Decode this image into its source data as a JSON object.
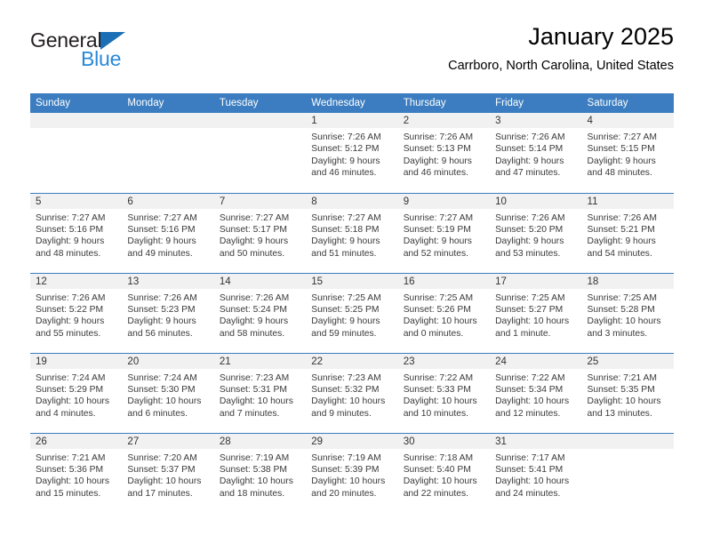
{
  "brand": {
    "name_top": "General",
    "name_bottom": "Blue",
    "triangle_icon": "triangle-icon",
    "accent_dark": "#1b6fb5",
    "accent_light": "#2789d8"
  },
  "header": {
    "title": "January 2025",
    "location": "Carrboro, North Carolina, United States"
  },
  "theme": {
    "header_bar": "#3b7dc0",
    "daynum_band": "#f1f1f1",
    "text": "#3a3a3a"
  },
  "calendar": {
    "weekday_headers": [
      "Sunday",
      "Monday",
      "Tuesday",
      "Wednesday",
      "Thursday",
      "Friday",
      "Saturday"
    ],
    "weeks": [
      [
        {
          "day": "",
          "sunrise": "",
          "sunset": "",
          "daylight": ""
        },
        {
          "day": "",
          "sunrise": "",
          "sunset": "",
          "daylight": ""
        },
        {
          "day": "",
          "sunrise": "",
          "sunset": "",
          "daylight": ""
        },
        {
          "day": "1",
          "sunrise": "Sunrise: 7:26 AM",
          "sunset": "Sunset: 5:12 PM",
          "daylight": "Daylight: 9 hours and 46 minutes."
        },
        {
          "day": "2",
          "sunrise": "Sunrise: 7:26 AM",
          "sunset": "Sunset: 5:13 PM",
          "daylight": "Daylight: 9 hours and 46 minutes."
        },
        {
          "day": "3",
          "sunrise": "Sunrise: 7:26 AM",
          "sunset": "Sunset: 5:14 PM",
          "daylight": "Daylight: 9 hours and 47 minutes."
        },
        {
          "day": "4",
          "sunrise": "Sunrise: 7:27 AM",
          "sunset": "Sunset: 5:15 PM",
          "daylight": "Daylight: 9 hours and 48 minutes."
        }
      ],
      [
        {
          "day": "5",
          "sunrise": "Sunrise: 7:27 AM",
          "sunset": "Sunset: 5:16 PM",
          "daylight": "Daylight: 9 hours and 48 minutes."
        },
        {
          "day": "6",
          "sunrise": "Sunrise: 7:27 AM",
          "sunset": "Sunset: 5:16 PM",
          "daylight": "Daylight: 9 hours and 49 minutes."
        },
        {
          "day": "7",
          "sunrise": "Sunrise: 7:27 AM",
          "sunset": "Sunset: 5:17 PM",
          "daylight": "Daylight: 9 hours and 50 minutes."
        },
        {
          "day": "8",
          "sunrise": "Sunrise: 7:27 AM",
          "sunset": "Sunset: 5:18 PM",
          "daylight": "Daylight: 9 hours and 51 minutes."
        },
        {
          "day": "9",
          "sunrise": "Sunrise: 7:27 AM",
          "sunset": "Sunset: 5:19 PM",
          "daylight": "Daylight: 9 hours and 52 minutes."
        },
        {
          "day": "10",
          "sunrise": "Sunrise: 7:26 AM",
          "sunset": "Sunset: 5:20 PM",
          "daylight": "Daylight: 9 hours and 53 minutes."
        },
        {
          "day": "11",
          "sunrise": "Sunrise: 7:26 AM",
          "sunset": "Sunset: 5:21 PM",
          "daylight": "Daylight: 9 hours and 54 minutes."
        }
      ],
      [
        {
          "day": "12",
          "sunrise": "Sunrise: 7:26 AM",
          "sunset": "Sunset: 5:22 PM",
          "daylight": "Daylight: 9 hours and 55 minutes."
        },
        {
          "day": "13",
          "sunrise": "Sunrise: 7:26 AM",
          "sunset": "Sunset: 5:23 PM",
          "daylight": "Daylight: 9 hours and 56 minutes."
        },
        {
          "day": "14",
          "sunrise": "Sunrise: 7:26 AM",
          "sunset": "Sunset: 5:24 PM",
          "daylight": "Daylight: 9 hours and 58 minutes."
        },
        {
          "day": "15",
          "sunrise": "Sunrise: 7:25 AM",
          "sunset": "Sunset: 5:25 PM",
          "daylight": "Daylight: 9 hours and 59 minutes."
        },
        {
          "day": "16",
          "sunrise": "Sunrise: 7:25 AM",
          "sunset": "Sunset: 5:26 PM",
          "daylight": "Daylight: 10 hours and 0 minutes."
        },
        {
          "day": "17",
          "sunrise": "Sunrise: 7:25 AM",
          "sunset": "Sunset: 5:27 PM",
          "daylight": "Daylight: 10 hours and 1 minute."
        },
        {
          "day": "18",
          "sunrise": "Sunrise: 7:25 AM",
          "sunset": "Sunset: 5:28 PM",
          "daylight": "Daylight: 10 hours and 3 minutes."
        }
      ],
      [
        {
          "day": "19",
          "sunrise": "Sunrise: 7:24 AM",
          "sunset": "Sunset: 5:29 PM",
          "daylight": "Daylight: 10 hours and 4 minutes."
        },
        {
          "day": "20",
          "sunrise": "Sunrise: 7:24 AM",
          "sunset": "Sunset: 5:30 PM",
          "daylight": "Daylight: 10 hours and 6 minutes."
        },
        {
          "day": "21",
          "sunrise": "Sunrise: 7:23 AM",
          "sunset": "Sunset: 5:31 PM",
          "daylight": "Daylight: 10 hours and 7 minutes."
        },
        {
          "day": "22",
          "sunrise": "Sunrise: 7:23 AM",
          "sunset": "Sunset: 5:32 PM",
          "daylight": "Daylight: 10 hours and 9 minutes."
        },
        {
          "day": "23",
          "sunrise": "Sunrise: 7:22 AM",
          "sunset": "Sunset: 5:33 PM",
          "daylight": "Daylight: 10 hours and 10 minutes."
        },
        {
          "day": "24",
          "sunrise": "Sunrise: 7:22 AM",
          "sunset": "Sunset: 5:34 PM",
          "daylight": "Daylight: 10 hours and 12 minutes."
        },
        {
          "day": "25",
          "sunrise": "Sunrise: 7:21 AM",
          "sunset": "Sunset: 5:35 PM",
          "daylight": "Daylight: 10 hours and 13 minutes."
        }
      ],
      [
        {
          "day": "26",
          "sunrise": "Sunrise: 7:21 AM",
          "sunset": "Sunset: 5:36 PM",
          "daylight": "Daylight: 10 hours and 15 minutes."
        },
        {
          "day": "27",
          "sunrise": "Sunrise: 7:20 AM",
          "sunset": "Sunset: 5:37 PM",
          "daylight": "Daylight: 10 hours and 17 minutes."
        },
        {
          "day": "28",
          "sunrise": "Sunrise: 7:19 AM",
          "sunset": "Sunset: 5:38 PM",
          "daylight": "Daylight: 10 hours and 18 minutes."
        },
        {
          "day": "29",
          "sunrise": "Sunrise: 7:19 AM",
          "sunset": "Sunset: 5:39 PM",
          "daylight": "Daylight: 10 hours and 20 minutes."
        },
        {
          "day": "30",
          "sunrise": "Sunrise: 7:18 AM",
          "sunset": "Sunset: 5:40 PM",
          "daylight": "Daylight: 10 hours and 22 minutes."
        },
        {
          "day": "31",
          "sunrise": "Sunrise: 7:17 AM",
          "sunset": "Sunset: 5:41 PM",
          "daylight": "Daylight: 10 hours and 24 minutes."
        },
        {
          "day": "",
          "sunrise": "",
          "sunset": "",
          "daylight": ""
        }
      ]
    ]
  }
}
